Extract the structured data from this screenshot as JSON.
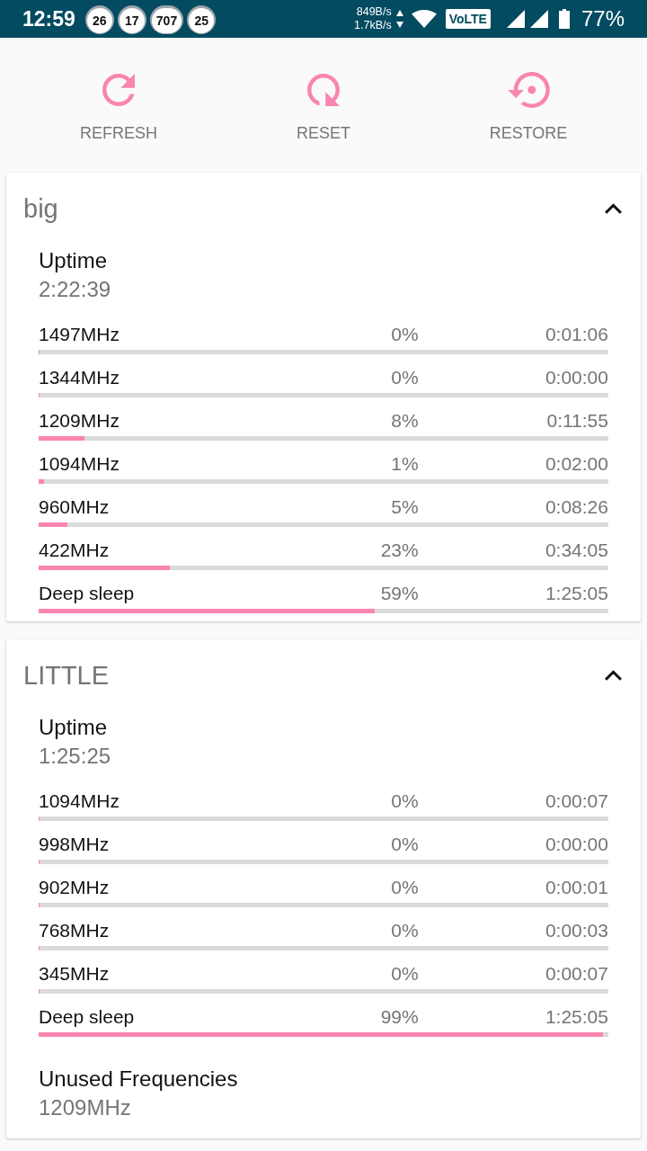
{
  "status_bar": {
    "time": "12:59",
    "notifications": [
      "26",
      "17",
      "707",
      "25"
    ],
    "upload_speed": "849B/s",
    "download_speed": "1.7kB/s",
    "volte": "VoLTE",
    "battery": "77%"
  },
  "actions": [
    {
      "kind": "refresh",
      "label": "REFRESH"
    },
    {
      "kind": "reset",
      "label": "RESET"
    },
    {
      "kind": "restore",
      "label": "RESTORE"
    }
  ],
  "cards": [
    {
      "title": "big",
      "expanded": true,
      "uptime": {
        "label": "Uptime",
        "value": "2:22:39"
      },
      "rows": [
        {
          "label": "1497MHz",
          "percent": "0%",
          "duration": "0:01:06",
          "level": 0
        },
        {
          "label": "1344MHz",
          "percent": "0%",
          "duration": "0:00:00",
          "level": 0
        },
        {
          "label": "1209MHz",
          "percent": "8%",
          "duration": "0:11:55",
          "level": 0.08
        },
        {
          "label": "1094MHz",
          "percent": "1%",
          "duration": "0:02:00",
          "level": 0.01
        },
        {
          "label": "960MHz",
          "percent": "5%",
          "duration": "0:08:26",
          "level": 0.05
        },
        {
          "label": "422MHz",
          "percent": "23%",
          "duration": "0:34:05",
          "level": 0.23
        },
        {
          "label": "Deep sleep",
          "percent": "59%",
          "duration": "1:25:05",
          "level": 0.59
        }
      ]
    },
    {
      "title": "LITTLE",
      "expanded": true,
      "uptime": {
        "label": "Uptime",
        "value": "1:25:25"
      },
      "rows": [
        {
          "label": "1094MHz",
          "percent": "0%",
          "duration": "0:00:07",
          "level": 0
        },
        {
          "label": "998MHz",
          "percent": "0%",
          "duration": "0:00:00",
          "level": 0
        },
        {
          "label": "902MHz",
          "percent": "0%",
          "duration": "0:00:01",
          "level": 0
        },
        {
          "label": "768MHz",
          "percent": "0%",
          "duration": "0:00:03",
          "level": 0
        },
        {
          "label": "345MHz",
          "percent": "0%",
          "duration": "0:00:07",
          "level": 0
        },
        {
          "label": "Deep sleep",
          "percent": "99%",
          "duration": "1:25:05",
          "level": 0.99
        }
      ],
      "unused": {
        "label": "Unused Frequencies",
        "value": "1209MHz"
      }
    }
  ]
}
